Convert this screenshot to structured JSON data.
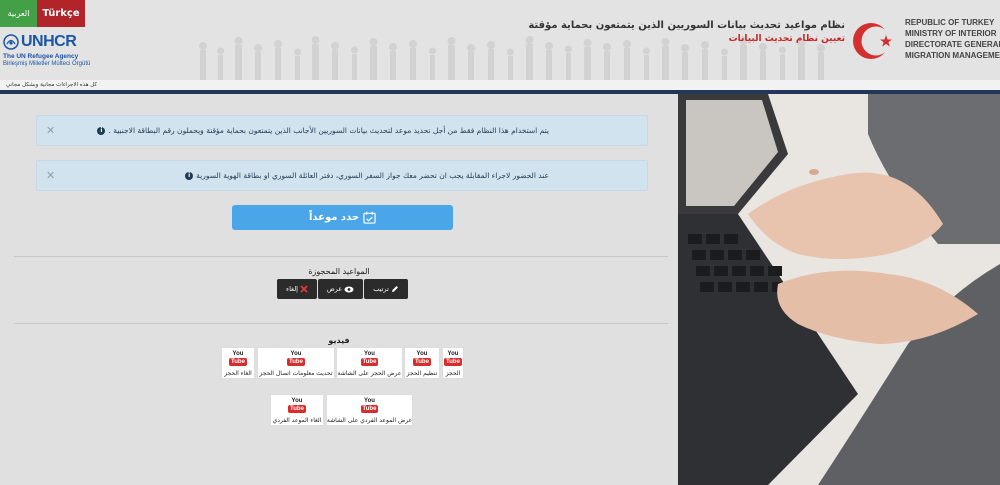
{
  "header": {
    "lang_ar": "العربية",
    "lang_tr": "Türkçe",
    "unhcr_name": "UNHCR",
    "unhcr_sub1": "The UN Refugee Agency",
    "unhcr_sub2": "Birleşmiş Milletler Mülteci Örgütü",
    "title_ar1": "نظام مواعيد تحديث بيانات السوريين الذين يتمتعون بحماية مؤقتة",
    "title_ar2": "تعيين نظام تحديث البيانات",
    "ministry": [
      "REPUBLIC OF TURKEY",
      "MINISTRY OF INTERIOR",
      "DIRECTORATE GENERAL OF",
      "MIGRATION MANAGEMENT"
    ]
  },
  "strip_text": "كل هذه الاجراءات مجانية وبشكل مجاني",
  "alerts": [
    {
      "text": "يتم استخدام هذا النظام فقط من أجل تحديد موعد لتحديث بيانات السوريين الأجانب الذين يتمتعون بحماية مؤقتة ويحملون رقم البطاقة الاجنبية ."
    },
    {
      "text": "عند الحضور لاجراء المقابلة يجب ان تحضر معك جواز السفر السوري، دفتر العائلة السوري او بطاقة الهوية السورية"
    }
  ],
  "book_button": "حدد موعداً",
  "reserved": {
    "title": "المواعيد المحجوزة",
    "edit": "ترتيب",
    "view": "عرض",
    "cancel": "إلغاء"
  },
  "videos": {
    "title": "فيديو",
    "items": [
      "الحجز",
      "تنظيم الحجز",
      "عرض الحجز على الشاشة",
      "تحديث معلومات اتصال الحجز",
      "الغاء الحجز",
      "عرض الموعد الفردي على الشاشة",
      "الغاء الموعد الفردي"
    ]
  },
  "colors": {
    "primary_button": "#4aa6e8",
    "alert_bg": "#d1e3ee",
    "lang_tr": "#b0242a",
    "lang_ar": "#43a047",
    "navy": "#24365a"
  }
}
